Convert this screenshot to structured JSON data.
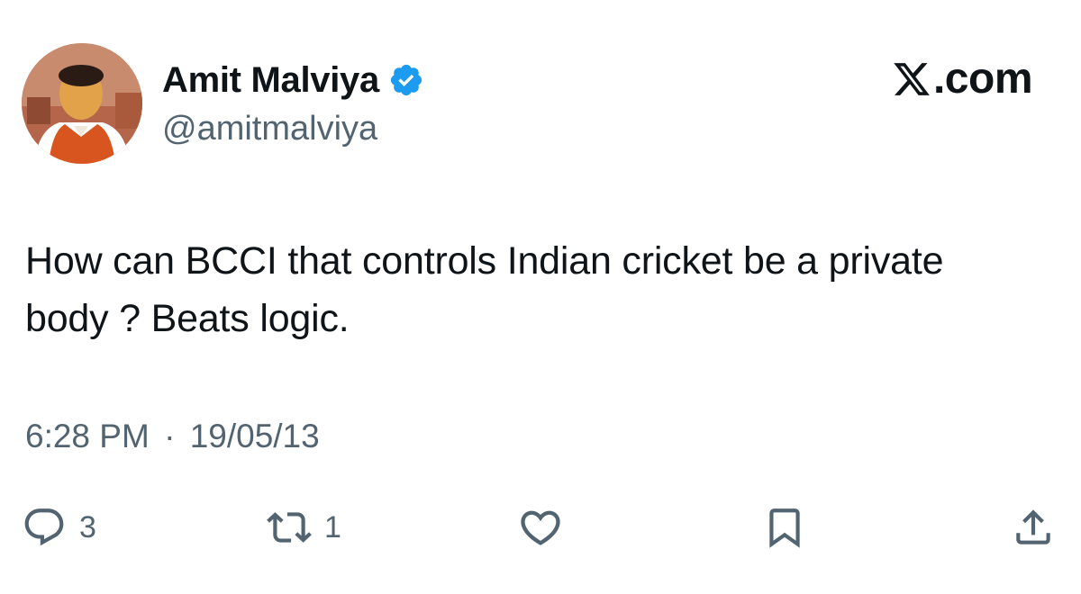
{
  "author": {
    "display_name": "Amit Malviya",
    "handle": "@amitmalviya",
    "avatar_icon": "profile-photo",
    "verified_icon": "verified-badge-icon",
    "verified_color": "#1d9bf0"
  },
  "brand": {
    "icon": "x-logo-icon",
    "suffix": ".com"
  },
  "tweet": {
    "text": "How can BCCI that controls Indian cricket be a private body ? Beats logic.",
    "time": "6:28 PM",
    "separator": "·",
    "date": "19/05/13"
  },
  "actions": {
    "reply": {
      "icon": "reply-icon",
      "count": "3"
    },
    "retweet": {
      "icon": "retweet-icon",
      "count": "1"
    },
    "like": {
      "icon": "heart-icon",
      "count": ""
    },
    "bookmark": {
      "icon": "bookmark-icon",
      "count": ""
    },
    "share": {
      "icon": "share-icon",
      "count": ""
    }
  },
  "colors": {
    "text_primary": "#0f1419",
    "text_secondary": "#536471",
    "verified": "#1d9bf0",
    "background": "#ffffff"
  }
}
